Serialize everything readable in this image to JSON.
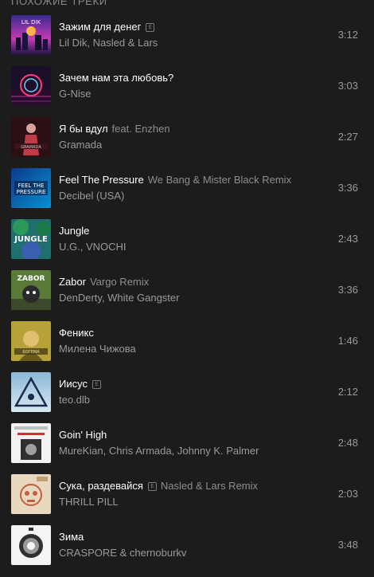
{
  "section": {
    "title": "Похожие треки"
  },
  "tracks": [
    {
      "title": "Зажим для денег",
      "version": "",
      "explicit": true,
      "artists": "Lil Dik, Nasled & Lars",
      "duration": "3:12",
      "cover_icon": "neon-city-cover"
    },
    {
      "title": "Зачем нам эта любовь?",
      "version": "",
      "explicit": false,
      "artists": "G-Nise",
      "duration": "3:03",
      "cover_icon": "neon-circle-cover"
    },
    {
      "title": "Я бы вдул",
      "version": "feat. Enzhen",
      "explicit": false,
      "artists": "Gramada",
      "duration": "2:27",
      "cover_icon": "figure-red-cover"
    },
    {
      "title": "Feel The Pressure",
      "version": "We Bang & Mister Black Remix",
      "explicit": false,
      "artists": "Decibel (USA)",
      "duration": "3:36",
      "cover_icon": "blue-text-cover"
    },
    {
      "title": "Jungle",
      "version": "",
      "explicit": false,
      "artists": "U.G., VNOCHI",
      "duration": "2:43",
      "cover_icon": "jungle-cover"
    },
    {
      "title": "Zabor",
      "version": "Vargo Remix",
      "explicit": false,
      "artists": "DenDerty, White Gangster",
      "duration": "3:36",
      "cover_icon": "green-character-cover"
    },
    {
      "title": "Феникс",
      "version": "",
      "explicit": false,
      "artists": "Милена Чижова",
      "duration": "1:46",
      "cover_icon": "gold-portrait-cover"
    },
    {
      "title": "Иисус",
      "version": "",
      "explicit": true,
      "artists": "teo.dlb",
      "duration": "2:12",
      "cover_icon": "triangle-eye-cover"
    },
    {
      "title": "Goin' High",
      "version": "",
      "explicit": false,
      "artists": "MureKian, Chris Armada, Johnny K. Palmer",
      "duration": "2:48",
      "cover_icon": "white-poster-cover"
    },
    {
      "title": "Сука, раздевайся",
      "version": "Nasled & Lars Remix",
      "explicit": true,
      "artists": "THRILL PILL",
      "duration": "2:03",
      "cover_icon": "skull-cover"
    },
    {
      "title": "Зима",
      "version": "",
      "explicit": false,
      "artists": "CRASPORE & chernoburkv",
      "duration": "3:48",
      "cover_icon": "ring-cover"
    }
  ],
  "explicit_label": "E",
  "colors": {
    "background": "#1c1c1c",
    "title": "#ffffff",
    "secondary": "#9a9a9a"
  }
}
